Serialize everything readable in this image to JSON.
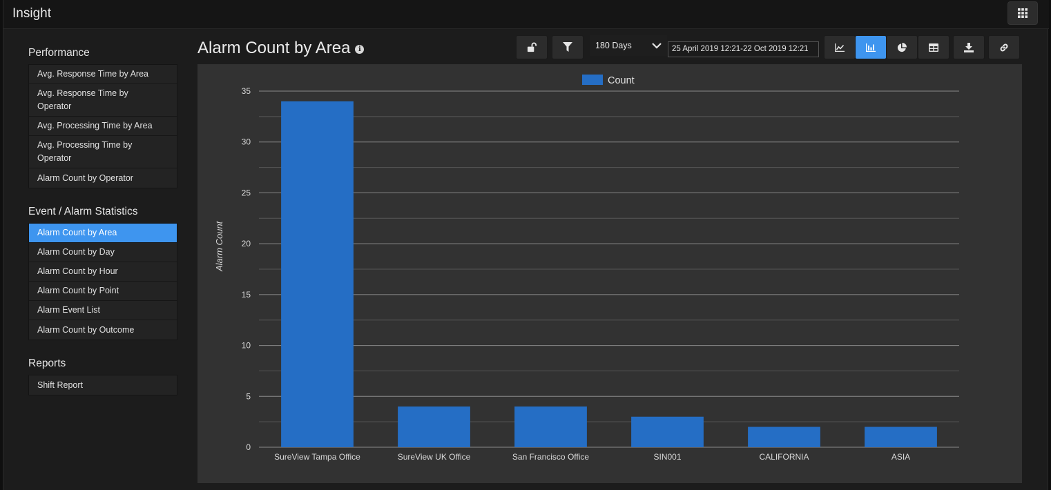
{
  "app": {
    "title": "Insight"
  },
  "sidebar": {
    "sections": [
      {
        "title": "Performance",
        "items": [
          {
            "label": "Avg. Response Time by Area"
          },
          {
            "label": "Avg. Response Time by Operator"
          },
          {
            "label": "Avg. Processing Time by Area"
          },
          {
            "label": "Avg. Processing Time by Operator"
          },
          {
            "label": "Alarm Count by Operator"
          }
        ]
      },
      {
        "title": "Event / Alarm Statistics",
        "items": [
          {
            "label": "Alarm Count by Area",
            "active": true
          },
          {
            "label": "Alarm Count by Day"
          },
          {
            "label": "Alarm Count by Hour"
          },
          {
            "label": "Alarm Count by Point"
          },
          {
            "label": "Alarm Event List"
          },
          {
            "label": "Alarm Count by Outcome"
          }
        ]
      },
      {
        "title": "Reports",
        "items": [
          {
            "label": "Shift Report"
          }
        ]
      }
    ]
  },
  "page": {
    "title": "Alarm Count by Area"
  },
  "toolbar": {
    "range_value": "180 Days",
    "date_range": "25 April 2019 12:21-22 Oct 2019 12:21",
    "chart_view_active": "bar"
  },
  "colors": {
    "accent": "#3e95ef",
    "bar": "#256ec5",
    "panel": "#323232"
  },
  "chart_data": {
    "type": "bar",
    "categories": [
      "SureView Tampa Office",
      "SureView UK Office",
      "San Francisco Office",
      "SIN001",
      "CALIFORNIA",
      "ASIA"
    ],
    "series": [
      {
        "name": "Count",
        "values": [
          34,
          4,
          4,
          3,
          2,
          2
        ]
      }
    ],
    "title": "",
    "xlabel": "",
    "ylabel": "Alarm Count",
    "ylim": [
      0,
      35
    ],
    "yticks": [
      0,
      5,
      10,
      15,
      20,
      25,
      30,
      35
    ],
    "legend": "top-center",
    "grid": true
  }
}
